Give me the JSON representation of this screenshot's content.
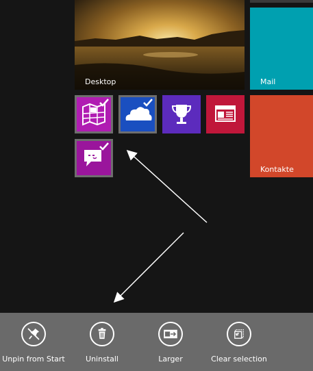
{
  "tiles": {
    "desktop": {
      "label": "Desktop"
    },
    "mail": {
      "label": "Mail",
      "color": "#00a0b0"
    },
    "kontakte": {
      "label": "Kontakte",
      "color": "#d2472a"
    },
    "maps": {
      "icon": "maps-icon",
      "color": "#b01cb2",
      "selected": true
    },
    "skydrive": {
      "icon": "skydrive-icon",
      "color": "#1a4fc0",
      "selected": true
    },
    "games": {
      "icon": "trophy-icon",
      "color": "#5c2bbd",
      "selected": false
    },
    "news": {
      "icon": "news-icon",
      "color": "#c0173a",
      "selected": false
    },
    "messaging": {
      "icon": "messaging-icon",
      "color": "#9a159c",
      "selected": true
    }
  },
  "app_bar": {
    "commands": [
      {
        "label": "Unpin from Start",
        "icon": "unpin-icon"
      },
      {
        "label": "Uninstall",
        "icon": "trash-icon"
      },
      {
        "label": "Larger",
        "icon": "resize-larger-icon"
      },
      {
        "label": "Clear selection",
        "icon": "clear-selection-icon"
      }
    ]
  }
}
